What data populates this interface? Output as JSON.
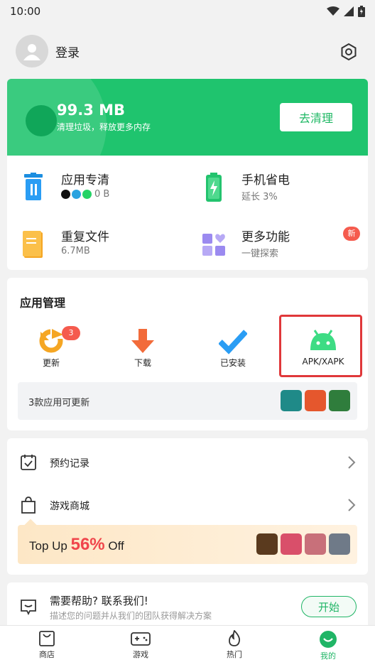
{
  "status_bar": {
    "time": "10:00"
  },
  "header": {
    "login_label": "登录"
  },
  "clean": {
    "size": "99.3 MB",
    "desc": "清理垃圾，释放更多内存",
    "button": "去清理"
  },
  "tools": [
    {
      "title": "应用专清",
      "sub": "0 B"
    },
    {
      "title": "手机省电",
      "sub": "延长 3%"
    },
    {
      "title": "重复文件",
      "sub": "6.7MB"
    },
    {
      "title": "更多功能",
      "sub": "一键探索",
      "badge": "新"
    }
  ],
  "app_management": {
    "title": "应用管理",
    "items": [
      {
        "label": "更新",
        "badge": "3"
      },
      {
        "label": "下载"
      },
      {
        "label": "已安装"
      },
      {
        "label": "APK/XAPK"
      }
    ],
    "update_text": "3款应用可更新"
  },
  "links": [
    {
      "label": "预约记录"
    },
    {
      "label": "游戏商城"
    }
  ],
  "topup": {
    "prefix": "Top Up ",
    "percent": "56%",
    "suffix": " Off"
  },
  "help": {
    "title": "需要帮助? 联系我们!",
    "sub": "描述您的问题并从我们的团队获得解决方案",
    "button": "开始"
  },
  "tabbar": [
    {
      "label": "商店"
    },
    {
      "label": "游戏"
    },
    {
      "label": "热门"
    },
    {
      "label": "我的",
      "active": true
    }
  ],
  "colors": {
    "accent": "#1fc46e",
    "badge": "#f55b4e",
    "highlight": "#e0383a"
  }
}
